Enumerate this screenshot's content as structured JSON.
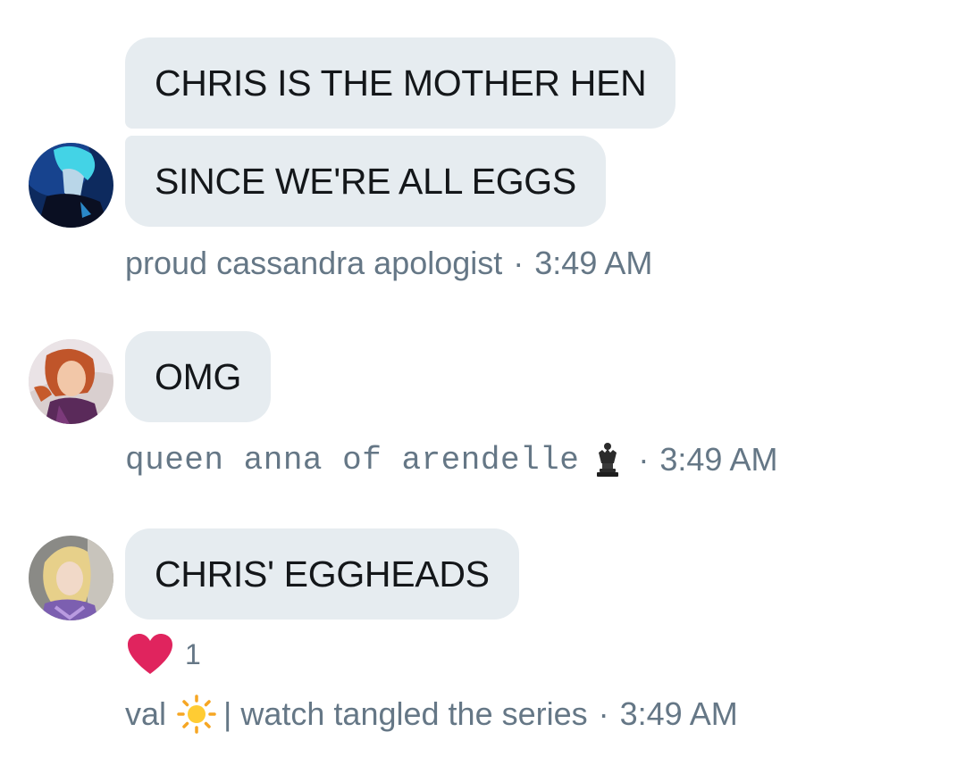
{
  "messages": [
    {
      "bubbles": [
        "CHRIS IS THE MOTHER HEN",
        "SINCE WE'RE ALL EGGS"
      ],
      "sender": "proud cassandra apologist",
      "time": "3:49 AM",
      "avatar_icon": "avatar-blue-haired-character"
    },
    {
      "bubbles": [
        "OMG"
      ],
      "sender": "queen anna of arendelle",
      "sender_emoji": "chess-queen-icon",
      "time": "3:49 AM",
      "avatar_icon": "avatar-anna-character"
    },
    {
      "bubbles": [
        "CHRIS' EGGHEADS"
      ],
      "reaction": {
        "icon": "heart-icon",
        "count": "1",
        "color": "#e0245e"
      },
      "sender_prefix": "val",
      "sender_emoji": "sun-icon",
      "sender_suffix": "| watch tangled the series",
      "time": "3:49 AM",
      "avatar_icon": "avatar-blonde-person"
    }
  ],
  "separator": "·",
  "colors": {
    "bubble": "#e6ecf0",
    "text": "#14171a",
    "meta": "#657786",
    "heart": "#e0245e"
  }
}
